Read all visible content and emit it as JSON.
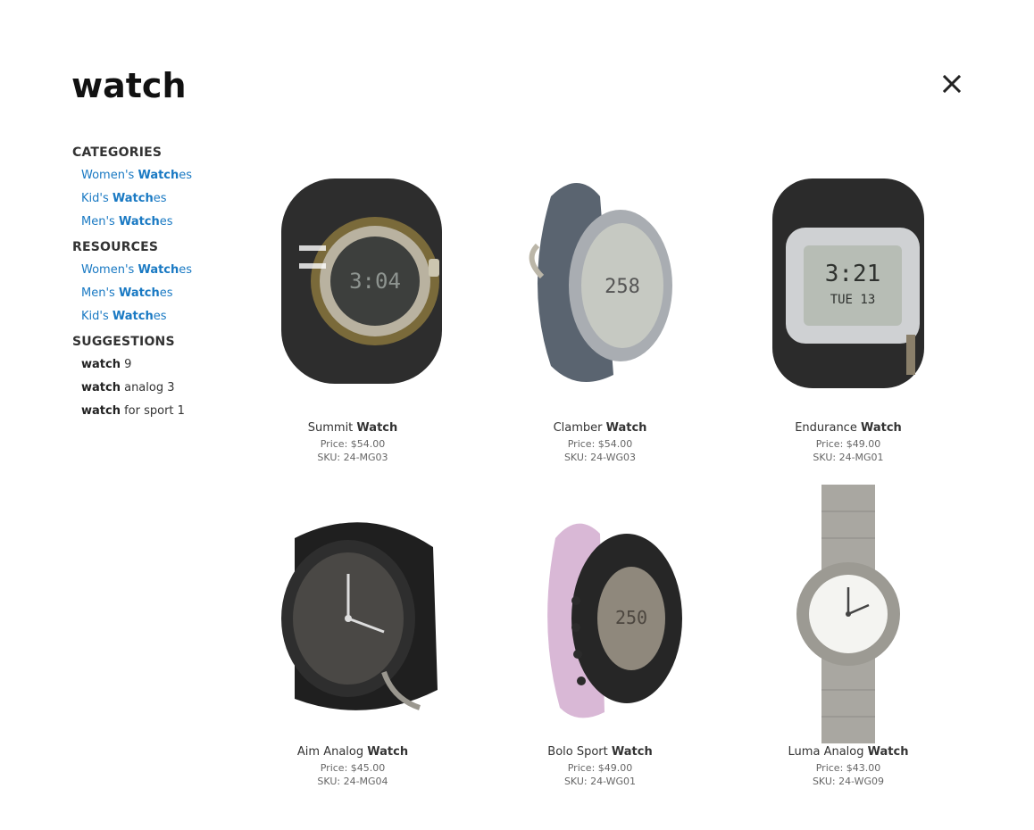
{
  "search": {
    "query": "watch"
  },
  "sidebar": {
    "categories": {
      "title": "CATEGORIES",
      "items": [
        {
          "prefix": "Women's ",
          "match": "Watch",
          "suffix": "es"
        },
        {
          "prefix": "Kid's ",
          "match": "Watch",
          "suffix": "es"
        },
        {
          "prefix": "Men's ",
          "match": "Watch",
          "suffix": "es"
        }
      ]
    },
    "resources": {
      "title": "RESOURCES",
      "items": [
        {
          "prefix": "Women's ",
          "match": "Watch",
          "suffix": "es"
        },
        {
          "prefix": "Men's ",
          "match": "Watch",
          "suffix": "es"
        },
        {
          "prefix": "Kid's ",
          "match": "Watch",
          "suffix": "es"
        }
      ]
    },
    "suggestions": {
      "title": "SUGGESTIONS",
      "items": [
        {
          "term": "watch",
          "rest": " 9"
        },
        {
          "term": "watch",
          "rest": " analog 3"
        },
        {
          "term": "watch",
          "rest": " for sport 1"
        }
      ]
    }
  },
  "products": [
    {
      "name_prefix": "Summit ",
      "name_match": "Watch",
      "price": "Price: $54.00",
      "sku": "SKU: 24-MG03",
      "image": "summit-watch"
    },
    {
      "name_prefix": "Clamber ",
      "name_match": "Watch",
      "price": "Price: $54.00",
      "sku": "SKU: 24-WG03",
      "image": "clamber-watch"
    },
    {
      "name_prefix": "Endurance ",
      "name_match": "Watch",
      "price": "Price: $49.00",
      "sku": "SKU: 24-MG01",
      "image": "endurance-watch"
    },
    {
      "name_prefix": "Aim Analog ",
      "name_match": "Watch",
      "price": "Price: $45.00",
      "sku": "SKU: 24-MG04",
      "image": "aim-analog-watch"
    },
    {
      "name_prefix": "Bolo Sport ",
      "name_match": "Watch",
      "price": "Price: $49.00",
      "sku": "SKU: 24-WG01",
      "image": "bolo-sport-watch"
    },
    {
      "name_prefix": "Luma Analog ",
      "name_match": "Watch",
      "price": "Price: $43.00",
      "sku": "SKU: 24-WG09",
      "image": "luma-analog-watch"
    }
  ],
  "icons": {
    "close": "close-icon"
  },
  "colors": {
    "link": "#1979c3",
    "text": "#333333"
  }
}
